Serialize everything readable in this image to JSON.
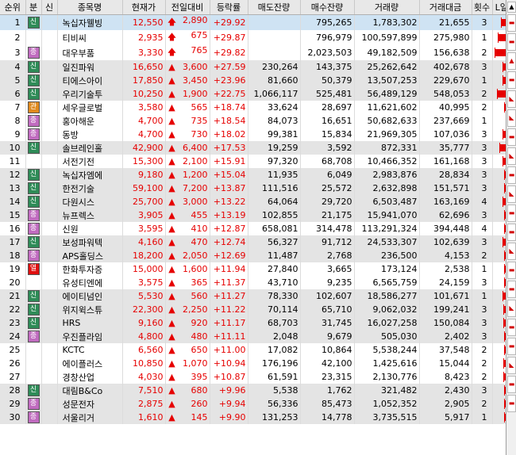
{
  "headers": {
    "idx": "순위",
    "badge": "분",
    "new": "신",
    "name": "종목명",
    "price": "현재가",
    "change": "전일대비",
    "rate": "등락률",
    "sell": "매도잔량",
    "buy": "매수잔량",
    "volume": "거래량",
    "amount": "거래대금",
    "count": "횟수",
    "chart": "L일봉H"
  },
  "badge_colors": {
    "신": "#2e8b57",
    "종": "#c06bbf",
    "관": "#e08a1e",
    "열": "#e01010"
  },
  "colors": {
    "up": "#e60000",
    "shade": "#e4e4e4",
    "selected": "#cfe3f3"
  },
  "rows": [
    {
      "idx": "1",
      "badge": "신",
      "name": "녹십자웰빙",
      "price": "12,550",
      "arrow": "up-limit",
      "change": "2,890",
      "rate": "+29.92",
      "sell": "",
      "buy": "795,265",
      "volume": "1,783,302",
      "amount": "21,655",
      "count": "3"
    },
    {
      "idx": "2",
      "badge": "",
      "name": "티비씨",
      "price": "2,935",
      "arrow": "up-limit",
      "change": "675",
      "rate": "+29.87",
      "sell": "",
      "buy": "796,979",
      "volume": "100,597,899",
      "amount": "275,980",
      "count": "1"
    },
    {
      "idx": "3",
      "badge": "종",
      "name": "대우부품",
      "price": "3,330",
      "arrow": "up-limit",
      "change": "765",
      "rate": "+29.82",
      "sell": "",
      "buy": "2,023,503",
      "volume": "49,182,509",
      "amount": "156,638",
      "count": "2"
    },
    {
      "idx": "4",
      "badge": "신",
      "name": "일진파워",
      "price": "16,650",
      "arrow": "up",
      "change": "3,600",
      "rate": "+27.59",
      "sell": "230,264",
      "buy": "143,375",
      "volume": "25,262,642",
      "amount": "402,678",
      "count": "3"
    },
    {
      "idx": "5",
      "badge": "신",
      "name": "티에스아이",
      "price": "17,850",
      "arrow": "up",
      "change": "3,450",
      "rate": "+23.96",
      "sell": "81,660",
      "buy": "50,379",
      "volume": "13,507,253",
      "amount": "229,670",
      "count": "1"
    },
    {
      "idx": "6",
      "badge": "신",
      "name": "우리기술투",
      "price": "10,250",
      "arrow": "up",
      "change": "1,900",
      "rate": "+22.75",
      "sell": "1,066,117",
      "buy": "525,481",
      "volume": "56,489,129",
      "amount": "548,053",
      "count": "2"
    },
    {
      "idx": "7",
      "badge": "관",
      "name": "세우글로벌",
      "price": "3,580",
      "arrow": "up",
      "change": "565",
      "rate": "+18.74",
      "sell": "33,624",
      "buy": "28,697",
      "volume": "11,621,602",
      "amount": "40,995",
      "count": "2"
    },
    {
      "idx": "8",
      "badge": "종",
      "name": "홍아해운",
      "price": "4,700",
      "arrow": "up",
      "change": "735",
      "rate": "+18.54",
      "sell": "84,073",
      "buy": "16,651",
      "volume": "50,682,633",
      "amount": "237,669",
      "count": "1"
    },
    {
      "idx": "9",
      "badge": "종",
      "name": "동방",
      "price": "4,700",
      "arrow": "up",
      "change": "730",
      "rate": "+18.02",
      "sell": "99,381",
      "buy": "15,834",
      "volume": "21,969,305",
      "amount": "107,036",
      "count": "3"
    },
    {
      "idx": "10",
      "badge": "신",
      "name": "솔브레인홀",
      "price": "42,900",
      "arrow": "up",
      "change": "6,400",
      "rate": "+17.53",
      "sell": "19,259",
      "buy": "3,592",
      "volume": "872,331",
      "amount": "35,777",
      "count": "3"
    },
    {
      "idx": "11",
      "badge": "",
      "name": "서전기전",
      "price": "15,300",
      "arrow": "up",
      "change": "2,100",
      "rate": "+15.91",
      "sell": "97,320",
      "buy": "68,708",
      "volume": "10,466,352",
      "amount": "161,168",
      "count": "3"
    },
    {
      "idx": "12",
      "badge": "신",
      "name": "녹십자엠에",
      "price": "9,180",
      "arrow": "up",
      "change": "1,200",
      "rate": "+15.04",
      "sell": "11,935",
      "buy": "6,049",
      "volume": "2,983,876",
      "amount": "28,834",
      "count": "3"
    },
    {
      "idx": "13",
      "badge": "신",
      "name": "한전기술",
      "price": "59,100",
      "arrow": "up",
      "change": "7,200",
      "rate": "+13.87",
      "sell": "111,516",
      "buy": "25,572",
      "volume": "2,632,898",
      "amount": "151,571",
      "count": "3"
    },
    {
      "idx": "14",
      "badge": "신",
      "name": "다원시스",
      "price": "25,700",
      "arrow": "up",
      "change": "3,000",
      "rate": "+13.22",
      "sell": "64,064",
      "buy": "29,720",
      "volume": "6,503,487",
      "amount": "163,169",
      "count": "4"
    },
    {
      "idx": "15",
      "badge": "종",
      "name": "뉴프렉스",
      "price": "3,905",
      "arrow": "up",
      "change": "455",
      "rate": "+13.19",
      "sell": "102,855",
      "buy": "21,175",
      "volume": "15,941,070",
      "amount": "62,696",
      "count": "3"
    },
    {
      "idx": "16",
      "badge": "종",
      "name": "신원",
      "price": "3,595",
      "arrow": "up",
      "change": "410",
      "rate": "+12.87",
      "sell": "658,081",
      "buy": "314,478",
      "volume": "113,291,324",
      "amount": "394,448",
      "count": "4"
    },
    {
      "idx": "17",
      "badge": "신",
      "name": "보성파워텍",
      "price": "4,160",
      "arrow": "up",
      "change": "470",
      "rate": "+12.74",
      "sell": "56,327",
      "buy": "91,712",
      "volume": "24,533,307",
      "amount": "102,639",
      "count": "3"
    },
    {
      "idx": "18",
      "badge": "종",
      "name": "APS홀딩스",
      "price": "18,200",
      "arrow": "up",
      "change": "2,050",
      "rate": "+12.69",
      "sell": "11,487",
      "buy": "2,768",
      "volume": "236,500",
      "amount": "4,153",
      "count": "2"
    },
    {
      "idx": "19",
      "badge": "열",
      "name": "한화투자증",
      "price": "15,000",
      "arrow": "up",
      "change": "1,600",
      "rate": "+11.94",
      "sell": "27,840",
      "buy": "3,665",
      "volume": "173,124",
      "amount": "2,538",
      "count": "1"
    },
    {
      "idx": "20",
      "badge": "",
      "name": "유성티엔에",
      "price": "3,575",
      "arrow": "up",
      "change": "365",
      "rate": "+11.37",
      "sell": "43,710",
      "buy": "9,235",
      "volume": "6,565,759",
      "amount": "24,159",
      "count": "3"
    },
    {
      "idx": "21",
      "badge": "신",
      "name": "에이티넘인",
      "price": "5,530",
      "arrow": "up",
      "change": "560",
      "rate": "+11.27",
      "sell": "78,330",
      "buy": "102,607",
      "volume": "18,586,277",
      "amount": "101,671",
      "count": "1"
    },
    {
      "idx": "22",
      "badge": "신",
      "name": "위지윅스튜",
      "price": "22,300",
      "arrow": "up",
      "change": "2,250",
      "rate": "+11.22",
      "sell": "70,114",
      "buy": "65,710",
      "volume": "9,062,032",
      "amount": "199,241",
      "count": "3"
    },
    {
      "idx": "23",
      "badge": "신",
      "name": "HRS",
      "price": "9,160",
      "arrow": "up",
      "change": "920",
      "rate": "+11.17",
      "sell": "68,703",
      "buy": "31,745",
      "volume": "16,027,258",
      "amount": "150,084",
      "count": "3"
    },
    {
      "idx": "24",
      "badge": "종",
      "name": "우진플라임",
      "price": "4,800",
      "arrow": "up",
      "change": "480",
      "rate": "+11.11",
      "sell": "2,048",
      "buy": "9,679",
      "volume": "505,030",
      "amount": "2,402",
      "count": "3"
    },
    {
      "idx": "25",
      "badge": "",
      "name": "KCTC",
      "price": "6,560",
      "arrow": "up",
      "change": "650",
      "rate": "+11.00",
      "sell": "17,082",
      "buy": "10,864",
      "volume": "5,538,244",
      "amount": "37,548",
      "count": "2"
    },
    {
      "idx": "26",
      "badge": "",
      "name": "에이플러스",
      "price": "10,850",
      "arrow": "up",
      "change": "1,070",
      "rate": "+10.94",
      "sell": "176,196",
      "buy": "42,100",
      "volume": "1,425,616",
      "amount": "15,044",
      "count": "2"
    },
    {
      "idx": "27",
      "badge": "",
      "name": "경창산업",
      "price": "4,030",
      "arrow": "up",
      "change": "395",
      "rate": "+10.87",
      "sell": "61,591",
      "buy": "23,315",
      "volume": "2,130,776",
      "amount": "8,423",
      "count": "2"
    },
    {
      "idx": "28",
      "badge": "신",
      "name": "대림B&Co",
      "price": "7,510",
      "arrow": "up",
      "change": "680",
      "rate": "+9.96",
      "sell": "5,538",
      "buy": "1,762",
      "volume": "321,482",
      "amount": "2,430",
      "count": "3"
    },
    {
      "idx": "29",
      "badge": "종",
      "name": "성문전자",
      "price": "2,875",
      "arrow": "up",
      "change": "260",
      "rate": "+9.94",
      "sell": "56,336",
      "buy": "85,473",
      "volume": "1,052,352",
      "amount": "2,905",
      "count": "2"
    },
    {
      "idx": "30",
      "badge": "종",
      "name": "서울리거",
      "price": "1,610",
      "arrow": "up",
      "change": "145",
      "rate": "+9.90",
      "sell": "131,253",
      "buy": "14,778",
      "volume": "3,735,515",
      "amount": "5,917",
      "count": "1"
    }
  ]
}
